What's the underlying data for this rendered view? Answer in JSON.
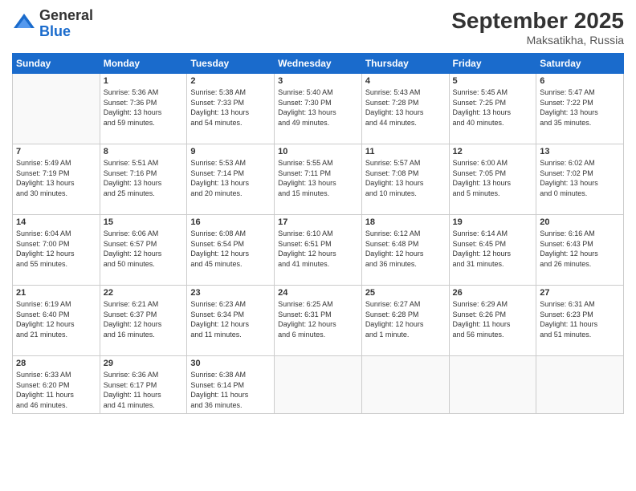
{
  "logo": {
    "general": "General",
    "blue": "Blue"
  },
  "header": {
    "month": "September 2025",
    "location": "Maksatikha, Russia"
  },
  "weekdays": [
    "Sunday",
    "Monday",
    "Tuesday",
    "Wednesday",
    "Thursday",
    "Friday",
    "Saturday"
  ],
  "weeks": [
    [
      {
        "day": "",
        "info": ""
      },
      {
        "day": "1",
        "info": "Sunrise: 5:36 AM\nSunset: 7:36 PM\nDaylight: 13 hours\nand 59 minutes."
      },
      {
        "day": "2",
        "info": "Sunrise: 5:38 AM\nSunset: 7:33 PM\nDaylight: 13 hours\nand 54 minutes."
      },
      {
        "day": "3",
        "info": "Sunrise: 5:40 AM\nSunset: 7:30 PM\nDaylight: 13 hours\nand 49 minutes."
      },
      {
        "day": "4",
        "info": "Sunrise: 5:43 AM\nSunset: 7:28 PM\nDaylight: 13 hours\nand 44 minutes."
      },
      {
        "day": "5",
        "info": "Sunrise: 5:45 AM\nSunset: 7:25 PM\nDaylight: 13 hours\nand 40 minutes."
      },
      {
        "day": "6",
        "info": "Sunrise: 5:47 AM\nSunset: 7:22 PM\nDaylight: 13 hours\nand 35 minutes."
      }
    ],
    [
      {
        "day": "7",
        "info": "Sunrise: 5:49 AM\nSunset: 7:19 PM\nDaylight: 13 hours\nand 30 minutes."
      },
      {
        "day": "8",
        "info": "Sunrise: 5:51 AM\nSunset: 7:16 PM\nDaylight: 13 hours\nand 25 minutes."
      },
      {
        "day": "9",
        "info": "Sunrise: 5:53 AM\nSunset: 7:14 PM\nDaylight: 13 hours\nand 20 minutes."
      },
      {
        "day": "10",
        "info": "Sunrise: 5:55 AM\nSunset: 7:11 PM\nDaylight: 13 hours\nand 15 minutes."
      },
      {
        "day": "11",
        "info": "Sunrise: 5:57 AM\nSunset: 7:08 PM\nDaylight: 13 hours\nand 10 minutes."
      },
      {
        "day": "12",
        "info": "Sunrise: 6:00 AM\nSunset: 7:05 PM\nDaylight: 13 hours\nand 5 minutes."
      },
      {
        "day": "13",
        "info": "Sunrise: 6:02 AM\nSunset: 7:02 PM\nDaylight: 13 hours\nand 0 minutes."
      }
    ],
    [
      {
        "day": "14",
        "info": "Sunrise: 6:04 AM\nSunset: 7:00 PM\nDaylight: 12 hours\nand 55 minutes."
      },
      {
        "day": "15",
        "info": "Sunrise: 6:06 AM\nSunset: 6:57 PM\nDaylight: 12 hours\nand 50 minutes."
      },
      {
        "day": "16",
        "info": "Sunrise: 6:08 AM\nSunset: 6:54 PM\nDaylight: 12 hours\nand 45 minutes."
      },
      {
        "day": "17",
        "info": "Sunrise: 6:10 AM\nSunset: 6:51 PM\nDaylight: 12 hours\nand 41 minutes."
      },
      {
        "day": "18",
        "info": "Sunrise: 6:12 AM\nSunset: 6:48 PM\nDaylight: 12 hours\nand 36 minutes."
      },
      {
        "day": "19",
        "info": "Sunrise: 6:14 AM\nSunset: 6:45 PM\nDaylight: 12 hours\nand 31 minutes."
      },
      {
        "day": "20",
        "info": "Sunrise: 6:16 AM\nSunset: 6:43 PM\nDaylight: 12 hours\nand 26 minutes."
      }
    ],
    [
      {
        "day": "21",
        "info": "Sunrise: 6:19 AM\nSunset: 6:40 PM\nDaylight: 12 hours\nand 21 minutes."
      },
      {
        "day": "22",
        "info": "Sunrise: 6:21 AM\nSunset: 6:37 PM\nDaylight: 12 hours\nand 16 minutes."
      },
      {
        "day": "23",
        "info": "Sunrise: 6:23 AM\nSunset: 6:34 PM\nDaylight: 12 hours\nand 11 minutes."
      },
      {
        "day": "24",
        "info": "Sunrise: 6:25 AM\nSunset: 6:31 PM\nDaylight: 12 hours\nand 6 minutes."
      },
      {
        "day": "25",
        "info": "Sunrise: 6:27 AM\nSunset: 6:28 PM\nDaylight: 12 hours\nand 1 minute."
      },
      {
        "day": "26",
        "info": "Sunrise: 6:29 AM\nSunset: 6:26 PM\nDaylight: 11 hours\nand 56 minutes."
      },
      {
        "day": "27",
        "info": "Sunrise: 6:31 AM\nSunset: 6:23 PM\nDaylight: 11 hours\nand 51 minutes."
      }
    ],
    [
      {
        "day": "28",
        "info": "Sunrise: 6:33 AM\nSunset: 6:20 PM\nDaylight: 11 hours\nand 46 minutes."
      },
      {
        "day": "29",
        "info": "Sunrise: 6:36 AM\nSunset: 6:17 PM\nDaylight: 11 hours\nand 41 minutes."
      },
      {
        "day": "30",
        "info": "Sunrise: 6:38 AM\nSunset: 6:14 PM\nDaylight: 11 hours\nand 36 minutes."
      },
      {
        "day": "",
        "info": ""
      },
      {
        "day": "",
        "info": ""
      },
      {
        "day": "",
        "info": ""
      },
      {
        "day": "",
        "info": ""
      }
    ]
  ]
}
